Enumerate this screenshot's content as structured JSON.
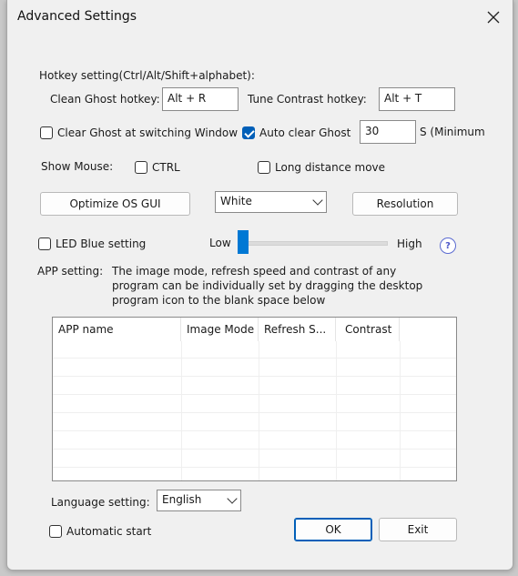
{
  "window": {
    "title": "Advanced Settings"
  },
  "hotkey": {
    "section_label": "Hotkey setting(Ctrl/Alt/Shift+alphabet):",
    "clean_label": "Clean Ghost hotkey:",
    "clean_value": "Alt + R",
    "tune_label": "Tune Contrast hotkey:",
    "tune_value": "Alt + T"
  },
  "ghost": {
    "clear_switch_label": "Clear Ghost at switching Window",
    "clear_switch_checked": false,
    "auto_clear_label": "Auto clear Ghost",
    "auto_clear_checked": true,
    "seconds_value": "30",
    "seconds_suffix": "S (Minimum"
  },
  "mouse": {
    "label": "Show Mouse:",
    "ctrl_label": "CTRL",
    "long_move_label": "Long distance move"
  },
  "buttons": {
    "optimize": "Optimize OS GUI",
    "resolution": "Resolution",
    "ok": "OK",
    "exit": "Exit"
  },
  "color_select": {
    "value": "White"
  },
  "led": {
    "label": "LED Blue setting",
    "low": "Low",
    "high": "High",
    "help": "?",
    "level": 0.0
  },
  "app": {
    "label": "APP setting:",
    "description_1": "The image mode, refresh speed and contrast of any",
    "description_2": "program can be individually set by dragging the desktop",
    "description_3": "program icon to the blank space below",
    "columns": [
      "APP name",
      "Image Mode",
      "Refresh S...",
      "Contrast"
    ],
    "rows": []
  },
  "language": {
    "label": "Language setting:",
    "value": "English"
  },
  "autostart": {
    "label": "Automatic start"
  },
  "colors": {
    "accent": "#005fb8",
    "slider": "#0078d4"
  }
}
